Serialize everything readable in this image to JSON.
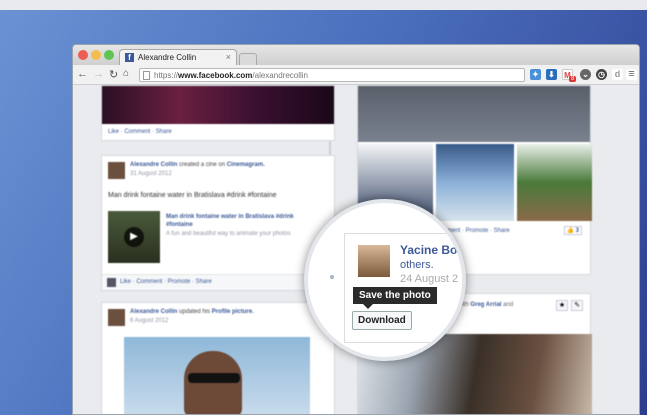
{
  "browser": {
    "tab_title": "Alexandre Collin",
    "url_prefix": "https://",
    "url_domain": "www.facebook.com",
    "url_path": "/alexandrecollin",
    "ext_badge": "8"
  },
  "left_col": {
    "post1_actions": "Like · Comment · Share",
    "post2": {
      "author": "Alexandre Collin",
      "action": "created a cine on",
      "app": "Cinemagram.",
      "date": "31 August 2012",
      "text": "Man drink fontaine water in Bratislava #drink #fontaine",
      "attach_title": "Man drink fontaine water in Bratislava #drink #fontaine",
      "attach_desc": "A fun and beautiful way to animate your photos",
      "actions": "Like · Comment · Promote · Share"
    },
    "post3": {
      "author": "Alexandre Collin",
      "action": "updated his",
      "link": "Profile picture.",
      "date": "6 August 2012"
    }
  },
  "right_col": {
    "actions": "Like · Comment · Promote · Share",
    "like_count": "3",
    "with_label": "with",
    "with_name": "Greg Arrial",
    "with_and": "and"
  },
  "magnifier": {
    "name": "Yacine Bo.",
    "others": "others.",
    "date": "24 August 2",
    "tooltip": "Save the photo",
    "download": "Download"
  }
}
